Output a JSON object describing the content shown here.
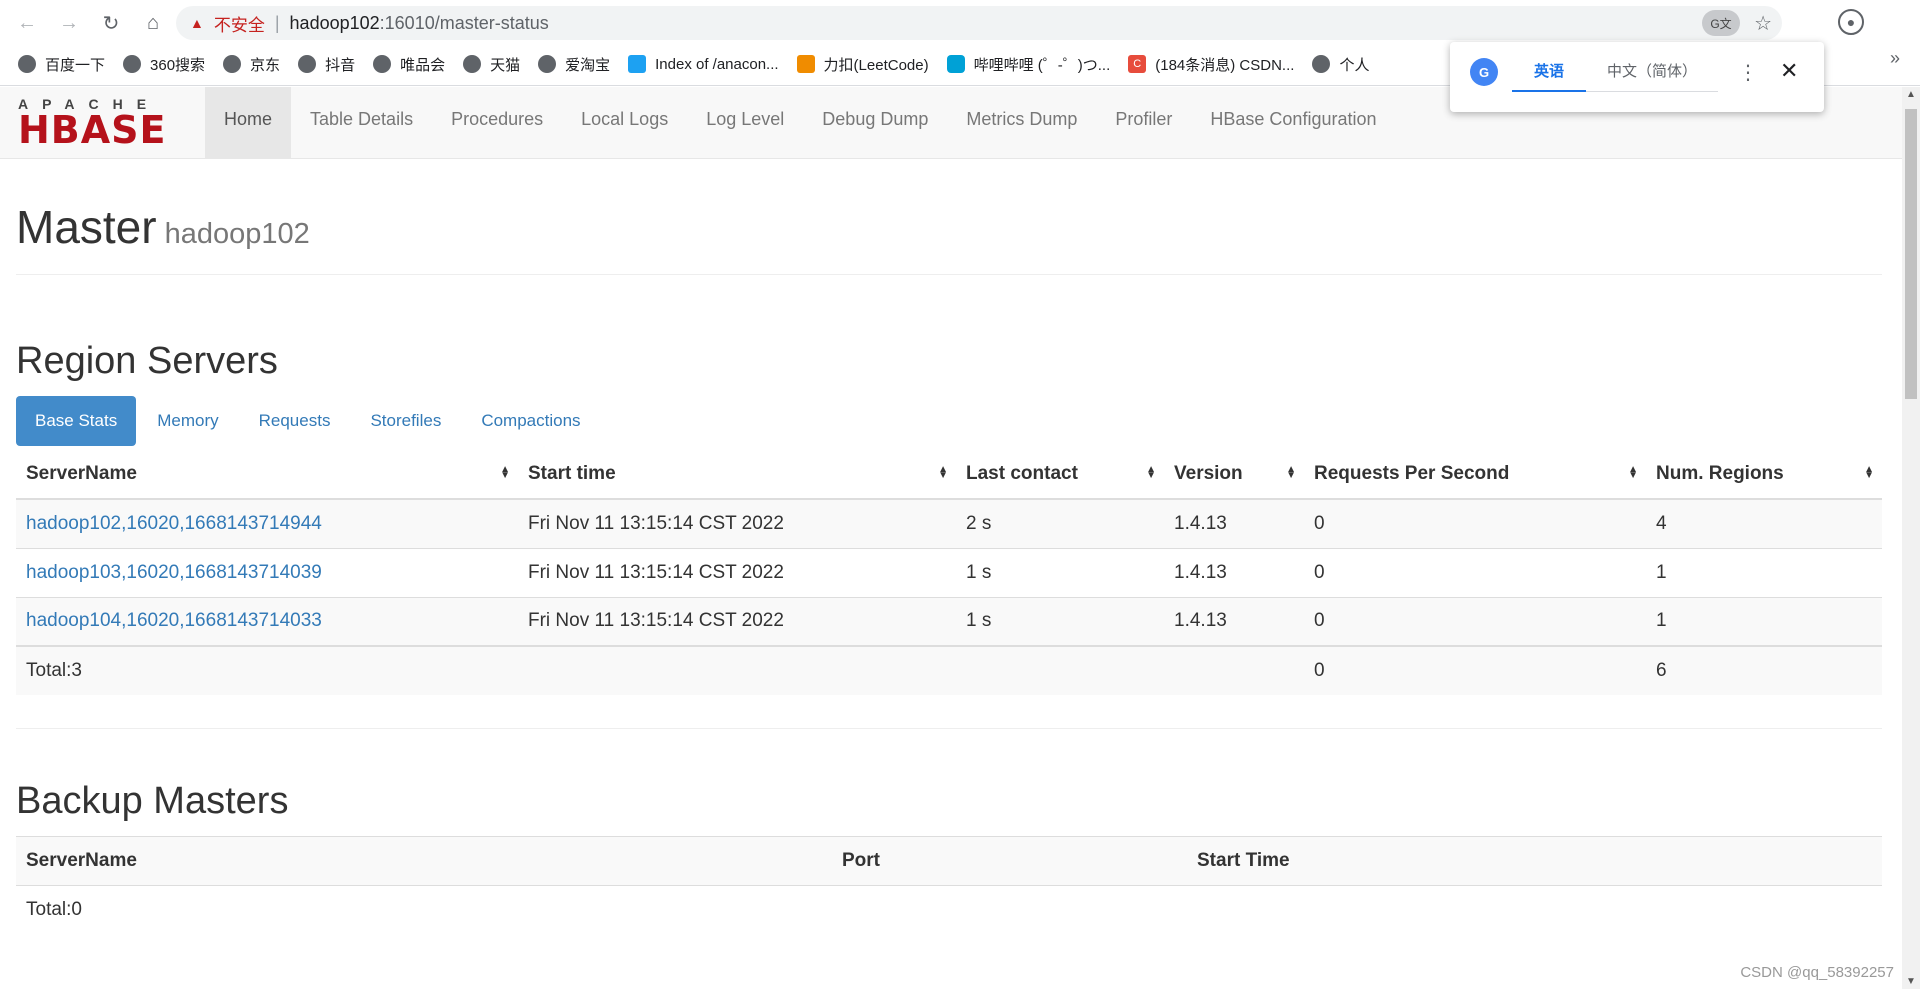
{
  "browser": {
    "security_warning": "不安全",
    "url_host": "hadoop102",
    "url_path": ":16010/master-status",
    "bookmarks": [
      {
        "label": "百度一下",
        "icon": "globe-icon"
      },
      {
        "label": "360搜索",
        "icon": "globe-icon"
      },
      {
        "label": "京东",
        "icon": "globe-icon"
      },
      {
        "label": "抖音",
        "icon": "globe-icon"
      },
      {
        "label": "唯品会",
        "icon": "globe-icon"
      },
      {
        "label": "天猫",
        "icon": "globe-icon"
      },
      {
        "label": "爱淘宝",
        "icon": "globe-icon"
      },
      {
        "label": "Index of /anacon...",
        "icon": "bird-icon"
      },
      {
        "label": "力扣(LeetCode)",
        "icon": "leetcode-icon"
      },
      {
        "label": "哔哩哔哩 (゜-゜)つ...",
        "icon": "bilibili-icon"
      },
      {
        "label": "(184条消息) CSDN...",
        "icon": "csdn-icon"
      },
      {
        "label": "个人",
        "icon": "globe-icon"
      }
    ],
    "more_bookmarks": "»"
  },
  "translate_popup": {
    "tab_source": "英语",
    "tab_target": "中文（简体）"
  },
  "hbase_nav": {
    "logo_top": "APACHE",
    "logo_main": "HBASE",
    "links": [
      "Home",
      "Table Details",
      "Procedures",
      "Local Logs",
      "Log Level",
      "Debug Dump",
      "Metrics Dump",
      "Profiler",
      "HBase Configuration"
    ]
  },
  "header": {
    "title": "Master",
    "subtitle": "hadoop102"
  },
  "region_servers": {
    "title": "Region Servers",
    "tabs": [
      "Base Stats",
      "Memory",
      "Requests",
      "Storefiles",
      "Compactions"
    ],
    "columns": [
      "ServerName",
      "Start time",
      "Last contact",
      "Version",
      "Requests Per Second",
      "Num. Regions"
    ],
    "rows": [
      {
        "server": "hadoop102,16020,1668143714944",
        "start": "Fri Nov 11 13:15:14 CST 2022",
        "contact": "2 s",
        "version": "1.4.13",
        "rps": "0",
        "regions": "4"
      },
      {
        "server": "hadoop103,16020,1668143714039",
        "start": "Fri Nov 11 13:15:14 CST 2022",
        "contact": "1 s",
        "version": "1.4.13",
        "rps": "0",
        "regions": "1"
      },
      {
        "server": "hadoop104,16020,1668143714033",
        "start": "Fri Nov 11 13:15:14 CST 2022",
        "contact": "1 s",
        "version": "1.4.13",
        "rps": "0",
        "regions": "1"
      }
    ],
    "total_label": "Total:3",
    "total_rps": "0",
    "total_regions": "6"
  },
  "backup_masters": {
    "title": "Backup Masters",
    "columns": [
      "ServerName",
      "Port",
      "Start Time"
    ],
    "total_label": "Total:0"
  },
  "watermark": "CSDN @qq_58392257"
}
